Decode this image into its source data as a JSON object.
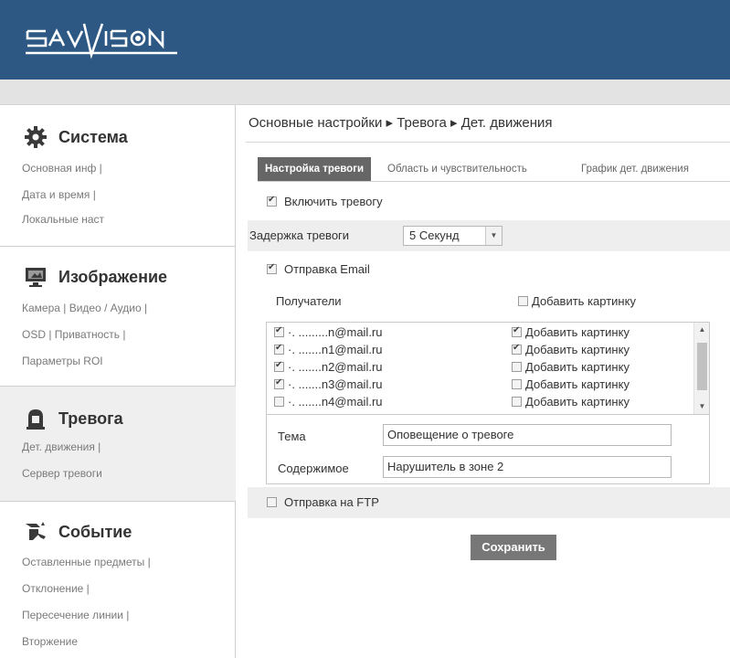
{
  "header": {
    "logo_text": "SAVVISION"
  },
  "sidebar": {
    "sections": [
      {
        "title": "Система",
        "icon": "gear-icon",
        "links": [
          "Основная инф |",
          "Дата и время |",
          "Локальные наст"
        ]
      },
      {
        "title": "Изображение",
        "icon": "monitor-icon",
        "links": [
          "Камера | Видео / Аудио |",
          "OSD | Приватность |",
          "Параметры ROI"
        ]
      },
      {
        "title": "Тревога",
        "icon": "alarm-icon",
        "links": [
          "Дет. движения |",
          "Сервер тревоги"
        ]
      },
      {
        "title": "Событие",
        "icon": "event-icon",
        "links": [
          "Оставленные предметы |",
          "Отклонение |",
          "Пересечение линии |",
          "Вторжение"
        ]
      }
    ]
  },
  "breadcrumb": "Основные настройки ▸ Тревога ▸ Дет. движения",
  "tabs": [
    "Настройка тревоги",
    "Область и чувствительность",
    "График дет. движения"
  ],
  "form": {
    "enable_alarm": {
      "label": "Включить тревогу",
      "checked": true
    },
    "delay": {
      "label": "Задержка тревоги",
      "value": "5 Секунд"
    },
    "send_email": {
      "label": "Отправка Email",
      "checked": true
    },
    "recipients_label": "Получатели",
    "add_picture_all": {
      "label": "Добавить картинку",
      "checked": false
    },
    "recipients": [
      {
        "email": "·. .........n@mail.ru",
        "checked": true,
        "picture_label": "Добавить картинку",
        "picture_checked": true
      },
      {
        "email": "·. .......n1@mail.ru",
        "checked": true,
        "picture_label": "Добавить картинку",
        "picture_checked": true
      },
      {
        "email": "·. .......n2@mail.ru",
        "checked": true,
        "picture_label": "Добавить картинку",
        "picture_checked": false
      },
      {
        "email": "·. .......n3@mail.ru",
        "checked": true,
        "picture_label": "Добавить картинку",
        "picture_checked": false
      },
      {
        "email": "·. .......n4@mail.ru",
        "checked": false,
        "picture_label": "Добавить картинку",
        "picture_checked": false
      }
    ],
    "subject": {
      "label": "Тема",
      "value": "Оповещение о тревоге"
    },
    "content": {
      "label": "Содержимое",
      "value": "Нарушитель в зоне 2"
    },
    "send_ftp": {
      "label": "Отправка на FTP",
      "checked": false
    },
    "save_label": "Сохранить"
  },
  "colors": {
    "header": "#2d5884",
    "button": "#777777",
    "active_tab": "#666666"
  }
}
